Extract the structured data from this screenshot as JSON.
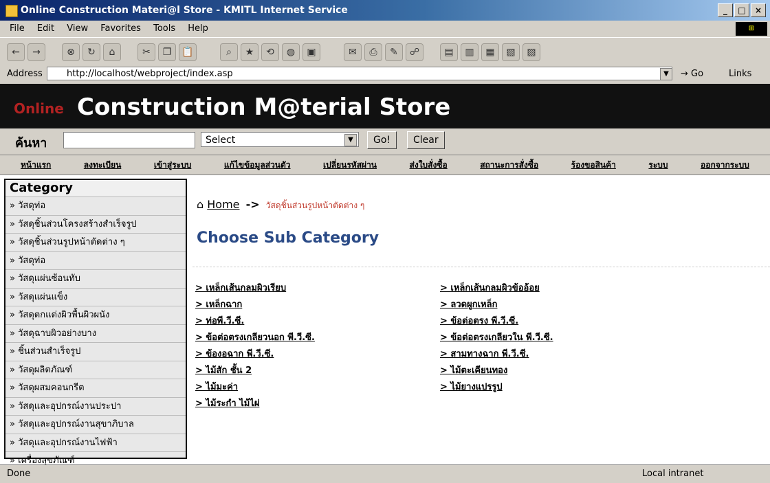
{
  "window": {
    "title": "Online Construction Materi@l Store - KMITL Internet Service",
    "buttons": [
      "_",
      "□",
      "×"
    ]
  },
  "menubar": [
    "File",
    "Edit",
    "View",
    "Favorites",
    "Tools",
    "Help"
  ],
  "address": {
    "label": "Address",
    "url": "http://localhost/webproject/index.asp",
    "go": "Go",
    "links": "Links"
  },
  "banner": {
    "online": "Online",
    "title": "Construction M@terial Store"
  },
  "search": {
    "label": "ค้นหา",
    "select_value": "Select",
    "go_button": "Go!",
    "clear_button": "Clear"
  },
  "nav": [
    "หน้าแรก",
    "ลงทะเบียน",
    "เข้าสู่ระบบ",
    "แก้ไขข้อมูลส่วนตัว",
    "เปลี่ยนรหัสผ่าน",
    "ส่งใบสั่งซื้อ",
    "สถานะการสั่งซื้อ",
    "ร้องขอสินค้า",
    "ระบบ",
    "ออกจากระบบ"
  ],
  "sidebar": {
    "title": "Category",
    "items": [
      "» วัสดุท่อ",
      "» วัสดุชิ้นส่วนโครงสร้างสำเร็จรูป",
      "» วัสดุชิ้นส่วนรูปหน้าตัดต่าง ๆ",
      "» วัสดุท่อ",
      "» วัสดุแผ่นซ้อนทับ",
      "» วัสดุแผ่นแข็ง",
      "» วัสดุตกแต่งผิวพื้นผิวผนัง",
      "» วัสดุฉาบผิวอย่างบาง",
      "» ชิ้นส่วนสำเร็จรูป",
      "» วัสดุผลิตภัณฑ์",
      "» วัสดุผสมคอนกรีต",
      "» วัสดุและอุปกรณ์งานประปา",
      "» วัสดุและอุปกรณ์งานสุขาภิบาล",
      "» วัสดุและอุปกรณ์งานไฟฟ้า",
      "» เครื่องสุขภัณฑ์"
    ]
  },
  "breadcrumb": {
    "home": "Home",
    "arrow": "->",
    "current": "วัสดุชิ้นส่วนรูปหน้าตัดต่าง ๆ"
  },
  "subcategory_title": "Choose Sub Category",
  "subcategories": {
    "left": [
      "> เหล็กเส้นกลมผิวเรียบ",
      "> เหล็กฉาก",
      "> ท่อพี.วี.ซี.",
      "> ข้อต่อตรงเกลียวนอก พี.วี.ซี.",
      "> ข้องอฉาก พี.วี.ซี.",
      "> ไม้สัก ชั้น 2",
      "> ไม้มะค่า",
      "> ไม้ระกำ ไม้ไผ่"
    ],
    "right": [
      "> เหล็กเส้นกลมผิวข้ออ้อย",
      "> ลวดผูกเหล็ก",
      "> ข้อต่อตรง พี.วี.ซี.",
      "> ข้อต่อตรงเกลียวใน พี.วี.ซี.",
      "> สามทางฉาก พี.วี.ซี.",
      "> ไม้ตะเคียนทอง",
      "> ไม้ยางแปรรูป"
    ]
  },
  "status": {
    "left": "Done",
    "right": "Local intranet"
  },
  "toolbar_icons": [
    "back-icon",
    "forward-icon",
    "stop-icon",
    "refresh-icon",
    "home-icon",
    "cut-icon",
    "copy-icon",
    "paste-icon",
    "search-icon",
    "favorites-icon",
    "history-icon",
    "mail-icon",
    "print-icon",
    "edit-icon",
    "discuss-icon"
  ]
}
